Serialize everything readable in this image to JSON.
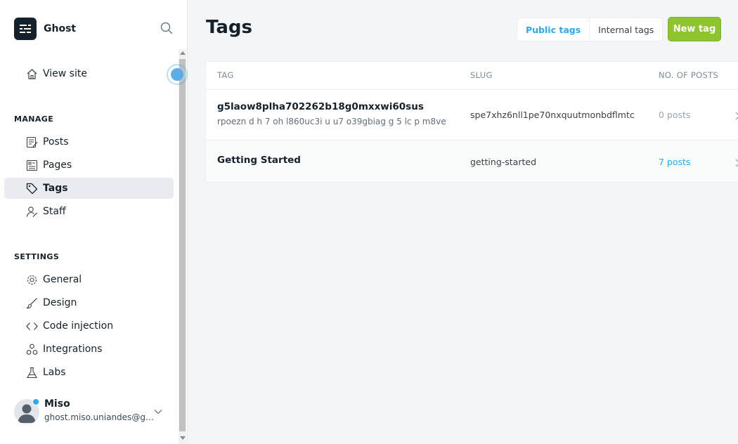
{
  "sidebar": {
    "brand": "Ghost",
    "view_site": "View site",
    "manage_title": "MANAGE",
    "manage_items": [
      {
        "label": "Posts",
        "icon": "posts-icon"
      },
      {
        "label": "Pages",
        "icon": "pages-icon"
      },
      {
        "label": "Tags",
        "icon": "tag-icon",
        "active": true
      },
      {
        "label": "Staff",
        "icon": "staff-icon"
      }
    ],
    "settings_title": "SETTINGS",
    "settings_items": [
      {
        "label": "General",
        "icon": "gear-icon"
      },
      {
        "label": "Design",
        "icon": "brush-icon"
      },
      {
        "label": "Code injection",
        "icon": "code-icon"
      },
      {
        "label": "Integrations",
        "icon": "integrations-icon"
      },
      {
        "label": "Labs",
        "icon": "flask-icon"
      }
    ],
    "user": {
      "name": "Miso",
      "email": "ghost.miso.uniandes@gmail.com"
    }
  },
  "header": {
    "title": "Tags",
    "tabs": [
      {
        "label": "Public tags",
        "active": true
      },
      {
        "label": "Internal tags",
        "active": false
      }
    ],
    "new_tag_label": "New tag"
  },
  "table": {
    "columns": [
      "TAG",
      "SLUG",
      "NO. OF POSTS"
    ],
    "rows": [
      {
        "name": "g5laow8plha702262b18g0mxxwi60sus",
        "description": "rpoezn d h 7 oh l860uc3i u u7 o39gbiag g 5 lc p m8ve",
        "slug": "spe7xhz6nll1pe70nxquutmonbdflmtc",
        "count": "0 posts"
      },
      {
        "name": "Getting Started",
        "description": "",
        "slug": "getting-started",
        "count": "7 posts"
      }
    ]
  },
  "colors": {
    "accent": "#30a7ef",
    "primary_button": "#8ec42e",
    "brand_dark": "#15212a"
  }
}
